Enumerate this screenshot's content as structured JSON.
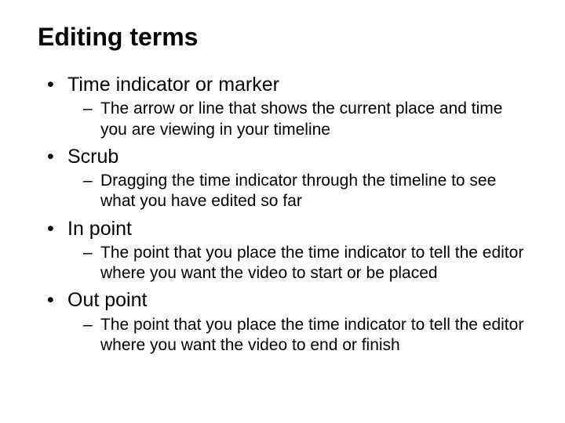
{
  "title": "Editing terms",
  "items": [
    {
      "term": "Time indicator or marker",
      "definition": "The arrow or line that shows the current place and time you are viewing in your timeline"
    },
    {
      "term": "Scrub",
      "definition": "Dragging the time indicator through the timeline to see what you have edited so far"
    },
    {
      "term": "In point",
      "definition": "The point that you place the time indicator to tell the editor where you want the video to start or be placed"
    },
    {
      "term": "Out point",
      "definition": "The point that you place the time indicator to tell the editor where you want the video to end or finish"
    }
  ]
}
